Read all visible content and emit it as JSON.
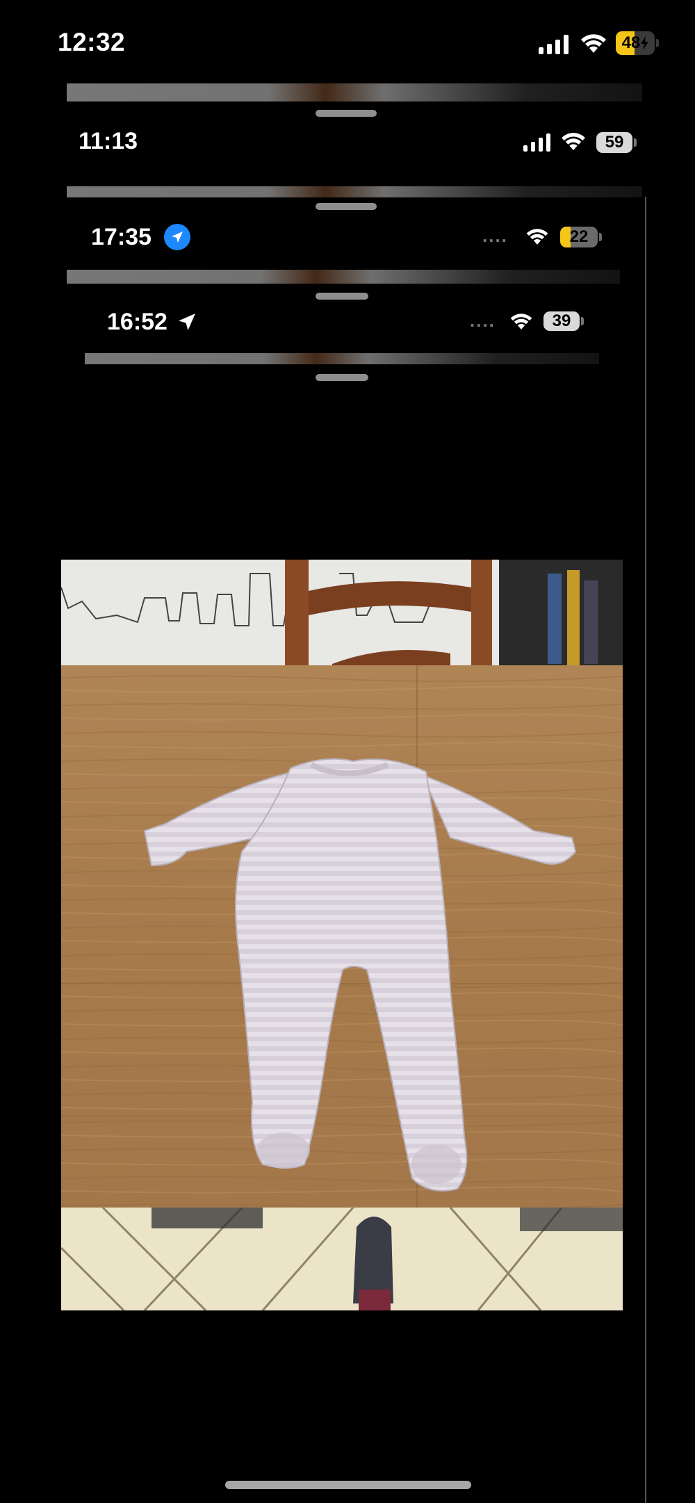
{
  "status_bar": {
    "time": "12:32",
    "battery_level": "48",
    "battery_charging": true,
    "battery_color": "#f5c518"
  },
  "layers": [
    {
      "time": "11:13",
      "battery_level": "59",
      "battery_color": "#d9d9d9",
      "location_icon": "none"
    },
    {
      "time": "17:35",
      "battery_level": "22",
      "battery_color": "#f5c518",
      "location_icon": "location-circle-icon",
      "signal": "...."
    },
    {
      "time": "16:52",
      "battery_level": "39",
      "battery_color": "#d9d9d9",
      "location_icon": "location-arrow-icon",
      "signal": "...."
    }
  ],
  "photo": {
    "subject": "baby-sleepsuit",
    "colors": {
      "table": "#a87d4f",
      "garment": "#d8d2d8",
      "wall": "#e9e9e6",
      "chair": "#8a4a26"
    }
  }
}
